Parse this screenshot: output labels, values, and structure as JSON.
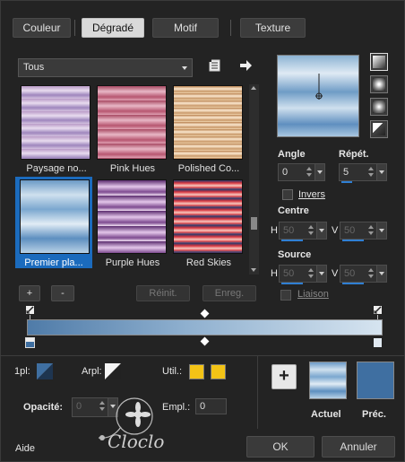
{
  "tabs": [
    {
      "label": "Couleur",
      "active": false
    },
    {
      "label": "Dégradé",
      "active": true
    },
    {
      "label": "Motif",
      "active": false
    },
    {
      "label": "Texture",
      "active": false
    }
  ],
  "category_dropdown": {
    "selected": "Tous"
  },
  "icons": {
    "library": "book-icon",
    "next": "arrow-right-icon"
  },
  "gradients": [
    {
      "label": "Paysage no...",
      "selected": false
    },
    {
      "label": "Pink Hues",
      "selected": false
    },
    {
      "label": "Polished Co...",
      "selected": false
    },
    {
      "label": "Premier pla...",
      "selected": true
    },
    {
      "label": "Purple Hues",
      "selected": false
    },
    {
      "label": "Red Skies",
      "selected": false
    }
  ],
  "list_buttons": {
    "add": "+",
    "remove": "-",
    "reset": "Réinit.",
    "save": "Enreg."
  },
  "angle": {
    "label": "Angle",
    "value": "0"
  },
  "repeat": {
    "label": "Répét.",
    "value": "5"
  },
  "invert": {
    "label": "Invers",
    "checked": false
  },
  "center": {
    "label": "Centre",
    "h_label": "H",
    "h_value": "50",
    "v_label": "V",
    "v_value": "50"
  },
  "source": {
    "label": "Source",
    "h_label": "H",
    "h_value": "50",
    "v_label": "V",
    "v_value": "50"
  },
  "link": {
    "label": "Liaison",
    "checked": false
  },
  "bottom": {
    "first_plan_label": "1pl:",
    "back_plan_label": "Arpl:",
    "user_label": "Util.:",
    "opacity_label": "Opacité:",
    "opacity_value": "0",
    "location_label": "Empl.:",
    "location_value": "0",
    "user_colors": [
      "#f3c316",
      "#f3c316"
    ]
  },
  "current": {
    "label": "Actuel",
    "add_icon": "+"
  },
  "previous": {
    "label": "Préc.",
    "color": "#3f6fa1"
  },
  "footer": {
    "help": "Aide",
    "ok": "OK",
    "cancel": "Annuler"
  },
  "watermark": "Cloclo",
  "colors": {
    "accent": "#2f7fd3",
    "selection": "#1b6bbd"
  }
}
